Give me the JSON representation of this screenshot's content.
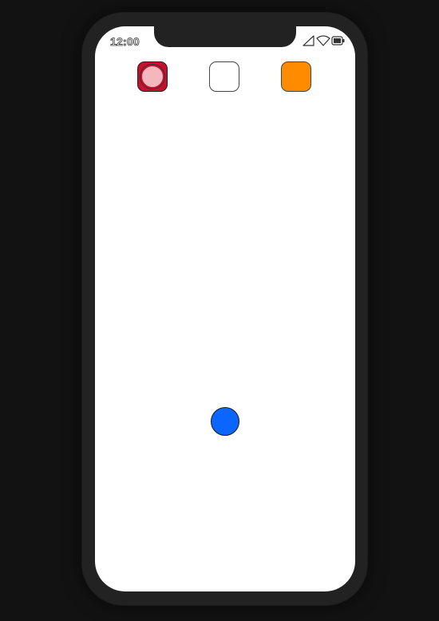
{
  "status_bar": {
    "time": "12:00",
    "icons": [
      "signal-icon",
      "wifi-icon",
      "battery-icon"
    ]
  },
  "toolbar": {
    "buttons": [
      {
        "name": "red-button",
        "color": "#c8102e",
        "inner_color": "#f4b8bc"
      },
      {
        "name": "white-button",
        "color": "#ffffff"
      },
      {
        "name": "orange-button",
        "color": "#ff8c00"
      }
    ]
  },
  "canvas": {
    "dot_color": "#0a66ff"
  },
  "colors": {
    "page_background": "#121212",
    "device_frame": "#222222",
    "screen": "#ffffff"
  }
}
